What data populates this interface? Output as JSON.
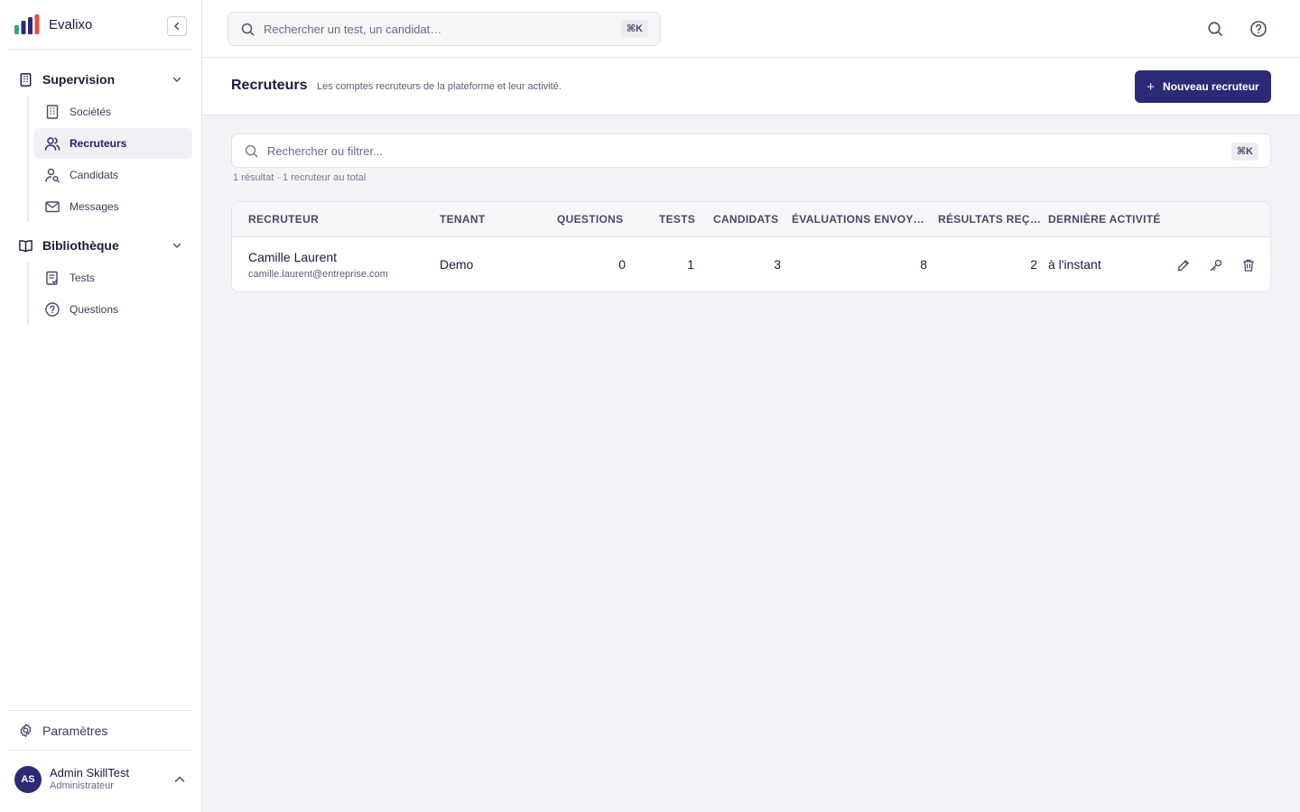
{
  "app": {
    "name": "Evalixo",
    "colors": {
      "primary": "#2b2a77",
      "logo_bars": [
        "#3aa37a",
        "#2b2a77",
        "#e0504a"
      ]
    }
  },
  "sidebar": {
    "sections": [
      {
        "title": "Supervision",
        "icon": "building-icon",
        "items": [
          {
            "label": "Sociétés",
            "icon": "building-icon",
            "active": false
          },
          {
            "label": "Recruteurs",
            "icon": "users-icon",
            "active": true
          },
          {
            "label": "Candidats",
            "icon": "user-search-icon",
            "active": false
          },
          {
            "label": "Messages",
            "icon": "mail-icon",
            "active": false
          }
        ]
      },
      {
        "title": "Bibliothèque",
        "icon": "book-icon",
        "items": [
          {
            "label": "Tests",
            "icon": "clipboard-check-icon",
            "active": false
          },
          {
            "label": "Questions",
            "icon": "help-circle-icon",
            "active": false
          }
        ]
      }
    ],
    "settings_label": "Paramètres",
    "user": {
      "initials": "AS",
      "name": "Admin SkillTest",
      "role": "Administrateur"
    }
  },
  "topbar": {
    "search_placeholder": "Rechercher un test, un candidat…",
    "search_shortcut": "⌘K"
  },
  "page": {
    "title": "Recruteurs",
    "subtitle": "Les comptes recruteurs de la plateforme et leur activité.",
    "new_button_label": "Nouveau recruteur",
    "filter_placeholder": "Rechercher ou filtrer...",
    "filter_shortcut": "⌘K",
    "result_count": "1 résultat · 1 recruteur au total"
  },
  "table": {
    "columns": [
      "RECRUTEUR",
      "TENANT",
      "QUESTIONS",
      "TESTS",
      "CANDIDATS",
      "ÉVALUATIONS ENVOY…",
      "RÉSULTATS REÇ…",
      "DERNIÈRE ACTIVITÉ"
    ],
    "rows": [
      {
        "name": "Camille Laurent",
        "email": "camille.laurent@entreprise.com",
        "tenant": "Demo",
        "questions": "0",
        "tests": "1",
        "candidats": "3",
        "evaluations": "8",
        "resultats": "2",
        "derniere_activite": "à l'instant"
      }
    ]
  }
}
